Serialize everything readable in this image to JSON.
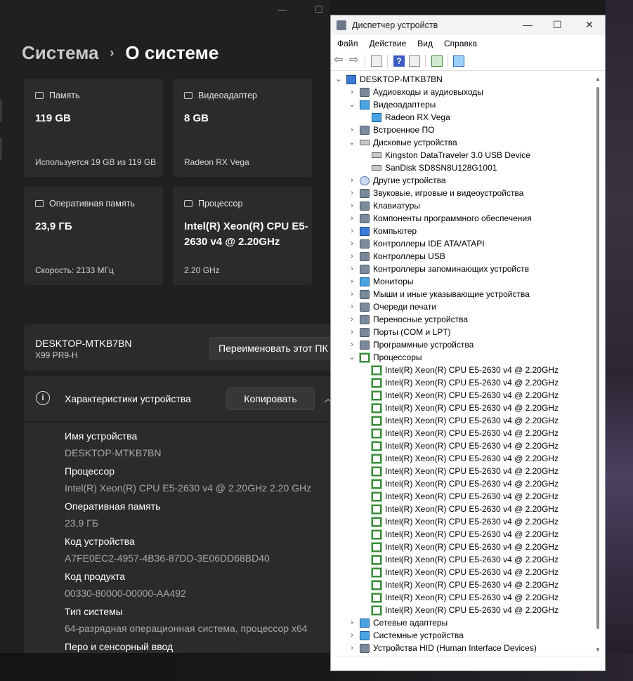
{
  "settings": {
    "breadcrumb_parent": "Система",
    "breadcrumb_sep": "›",
    "breadcrumb_current": "О системе",
    "window_controls": [
      "—",
      "☐"
    ],
    "cards": [
      {
        "title": "Память",
        "value": "119 GB",
        "sub": "Используется 19 GB из 119 GB",
        "icon": "storage-icon"
      },
      {
        "title": "Видеоадаптер",
        "value": "8 GB",
        "sub": "Radeon RX Vega",
        "icon": "gpu-icon"
      },
      {
        "title": "Оперативная память",
        "value": "23,9 ГБ",
        "sub": "Скорость: 2133 МГц",
        "icon": "ram-icon"
      },
      {
        "title": "Процессор",
        "value": "Intel(R) Xeon(R) CPU E5-2630 v4 @ 2.20GHz",
        "sub": "2.20 GHz",
        "icon": "cpu-icon"
      }
    ],
    "device_name": "DESKTOP-MTKB7BN",
    "device_model": "X99 PR9-H",
    "rename_button": "Переименовать этот ПК",
    "spec_title": "Характеристики устройства",
    "copy_button": "Копировать",
    "specs": [
      {
        "k": "Имя устройства",
        "v": "DESKTOP-MTKB7BN"
      },
      {
        "k": "Процессор",
        "v": "Intel(R) Xeon(R) CPU E5-2630 v4 @ 2.20GHz   2.20 GHz"
      },
      {
        "k": "Оперативная память",
        "v": "23,9 ГБ"
      },
      {
        "k": "Код устройства",
        "v": "A7FE0EC2-4957-4B36-87DD-3E06DD68BD40"
      },
      {
        "k": "Код продукта",
        "v": "00330-80000-00000-AA492"
      },
      {
        "k": "Тип системы",
        "v": "64-разрядная операционная система, процессор x64"
      },
      {
        "k": "Перо и сенсорный ввод",
        "v": ""
      }
    ]
  },
  "device_manager": {
    "title": "Диспетчер устройств",
    "menu": [
      "Файл",
      "Действие",
      "Вид",
      "Справка"
    ],
    "tree": [
      {
        "label": "DESKTOP-MTKB7BN",
        "level": 0,
        "exp": "⌄",
        "icon": "computer-icon"
      },
      {
        "label": "Аудиовходы и аудиовыходы",
        "level": 1,
        "exp": "›",
        "icon": "speaker-icon"
      },
      {
        "label": "Видеоадаптеры",
        "level": 1,
        "exp": "⌄",
        "icon": "display-adapter-icon"
      },
      {
        "label": "Radeon RX Vega",
        "level": 2,
        "exp": "",
        "icon": "display-adapter-icon"
      },
      {
        "label": "Встроенное ПО",
        "level": 1,
        "exp": "›",
        "icon": "firmware-icon"
      },
      {
        "label": "Дисковые устройства",
        "level": 1,
        "exp": "⌄",
        "icon": "disk-icon"
      },
      {
        "label": "Kingston DataTraveler 3.0 USB Device",
        "level": 2,
        "exp": "",
        "icon": "disk-icon"
      },
      {
        "label": "SanDisk SD8SN8U128G1001",
        "level": 2,
        "exp": "",
        "icon": "disk-icon"
      },
      {
        "label": "Другие устройства",
        "level": 1,
        "exp": "›",
        "icon": "unknown-device-icon"
      },
      {
        "label": "Звуковые, игровые и видеоустройства",
        "level": 1,
        "exp": "›",
        "icon": "speaker-icon"
      },
      {
        "label": "Клавиатуры",
        "level": 1,
        "exp": "›",
        "icon": "keyboard-icon"
      },
      {
        "label": "Компоненты программного обеспечения",
        "level": 1,
        "exp": "›",
        "icon": "software-component-icon"
      },
      {
        "label": "Компьютер",
        "level": 1,
        "exp": "›",
        "icon": "computer-icon"
      },
      {
        "label": "Контроллеры IDE ATA/ATAPI",
        "level": 1,
        "exp": "›",
        "icon": "ide-controller-icon"
      },
      {
        "label": "Контроллеры USB",
        "level": 1,
        "exp": "›",
        "icon": "usb-icon"
      },
      {
        "label": "Контроллеры запоминающих устройств",
        "level": 1,
        "exp": "›",
        "icon": "storage-controller-icon"
      },
      {
        "label": "Мониторы",
        "level": 1,
        "exp": "›",
        "icon": "monitor-icon"
      },
      {
        "label": "Мыши и иные указывающие устройства",
        "level": 1,
        "exp": "›",
        "icon": "mouse-icon"
      },
      {
        "label": "Очереди печати",
        "level": 1,
        "exp": "›",
        "icon": "printer-icon"
      },
      {
        "label": "Переносные устройства",
        "level": 1,
        "exp": "›",
        "icon": "portable-device-icon"
      },
      {
        "label": "Порты (COM и LPT)",
        "level": 1,
        "exp": "›",
        "icon": "port-icon"
      },
      {
        "label": "Программные устройства",
        "level": 1,
        "exp": "›",
        "icon": "software-device-icon"
      },
      {
        "label": "Процессоры",
        "level": 1,
        "exp": "⌄",
        "icon": "cpu-icon"
      },
      {
        "label": "Intel(R) Xeon(R) CPU E5-2630 v4 @ 2.20GHz",
        "level": 2,
        "exp": "",
        "icon": "cpu-icon"
      },
      {
        "label": "Intel(R) Xeon(R) CPU E5-2630 v4 @ 2.20GHz",
        "level": 2,
        "exp": "",
        "icon": "cpu-icon"
      },
      {
        "label": "Intel(R) Xeon(R) CPU E5-2630 v4 @ 2.20GHz",
        "level": 2,
        "exp": "",
        "icon": "cpu-icon"
      },
      {
        "label": "Intel(R) Xeon(R) CPU E5-2630 v4 @ 2.20GHz",
        "level": 2,
        "exp": "",
        "icon": "cpu-icon"
      },
      {
        "label": "Intel(R) Xeon(R) CPU E5-2630 v4 @ 2.20GHz",
        "level": 2,
        "exp": "",
        "icon": "cpu-icon"
      },
      {
        "label": "Intel(R) Xeon(R) CPU E5-2630 v4 @ 2.20GHz",
        "level": 2,
        "exp": "",
        "icon": "cpu-icon"
      },
      {
        "label": "Intel(R) Xeon(R) CPU E5-2630 v4 @ 2.20GHz",
        "level": 2,
        "exp": "",
        "icon": "cpu-icon"
      },
      {
        "label": "Intel(R) Xeon(R) CPU E5-2630 v4 @ 2.20GHz",
        "level": 2,
        "exp": "",
        "icon": "cpu-icon"
      },
      {
        "label": "Intel(R) Xeon(R) CPU E5-2630 v4 @ 2.20GHz",
        "level": 2,
        "exp": "",
        "icon": "cpu-icon"
      },
      {
        "label": "Intel(R) Xeon(R) CPU E5-2630 v4 @ 2.20GHz",
        "level": 2,
        "exp": "",
        "icon": "cpu-icon"
      },
      {
        "label": "Intel(R) Xeon(R) CPU E5-2630 v4 @ 2.20GHz",
        "level": 2,
        "exp": "",
        "icon": "cpu-icon"
      },
      {
        "label": "Intel(R) Xeon(R) CPU E5-2630 v4 @ 2.20GHz",
        "level": 2,
        "exp": "",
        "icon": "cpu-icon"
      },
      {
        "label": "Intel(R) Xeon(R) CPU E5-2630 v4 @ 2.20GHz",
        "level": 2,
        "exp": "",
        "icon": "cpu-icon"
      },
      {
        "label": "Intel(R) Xeon(R) CPU E5-2630 v4 @ 2.20GHz",
        "level": 2,
        "exp": "",
        "icon": "cpu-icon"
      },
      {
        "label": "Intel(R) Xeon(R) CPU E5-2630 v4 @ 2.20GHz",
        "level": 2,
        "exp": "",
        "icon": "cpu-icon"
      },
      {
        "label": "Intel(R) Xeon(R) CPU E5-2630 v4 @ 2.20GHz",
        "level": 2,
        "exp": "",
        "icon": "cpu-icon"
      },
      {
        "label": "Intel(R) Xeon(R) CPU E5-2630 v4 @ 2.20GHz",
        "level": 2,
        "exp": "",
        "icon": "cpu-icon"
      },
      {
        "label": "Intel(R) Xeon(R) CPU E5-2630 v4 @ 2.20GHz",
        "level": 2,
        "exp": "",
        "icon": "cpu-icon"
      },
      {
        "label": "Intel(R) Xeon(R) CPU E5-2630 v4 @ 2.20GHz",
        "level": 2,
        "exp": "",
        "icon": "cpu-icon"
      },
      {
        "label": "Intel(R) Xeon(R) CPU E5-2630 v4 @ 2.20GHz",
        "level": 2,
        "exp": "",
        "icon": "cpu-icon"
      },
      {
        "label": "Сетевые адаптеры",
        "level": 1,
        "exp": "›",
        "icon": "network-adapter-icon"
      },
      {
        "label": "Системные устройства",
        "level": 1,
        "exp": "›",
        "icon": "system-device-icon"
      },
      {
        "label": "Устройства HID (Human Interface Devices)",
        "level": 1,
        "exp": "›",
        "icon": "hid-icon"
      }
    ]
  }
}
